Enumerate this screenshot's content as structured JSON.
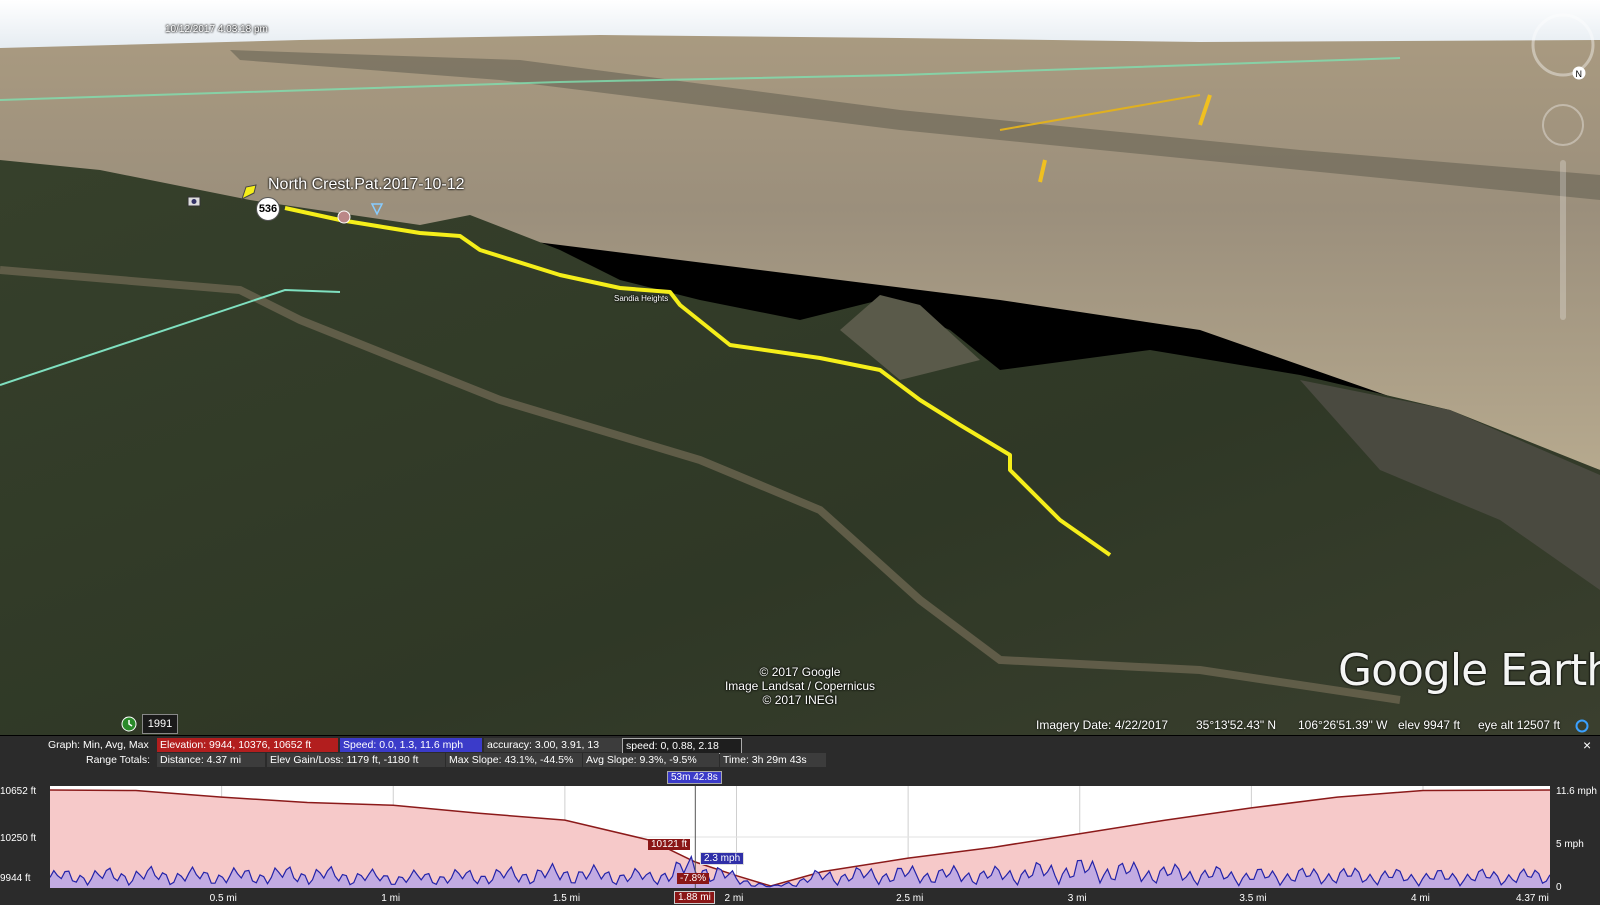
{
  "map": {
    "timestamp": "10/12/2017   4:03:18 pm",
    "track_label": "North Crest.Pat.2017-10-12",
    "track_marker_number": "536",
    "waypoint_label": "Sandia Heights",
    "copyright_lines": [
      "© 2017 Google",
      "Image Landsat / Copernicus",
      "© 2017 INEGI"
    ],
    "logo": "Google Earth",
    "historical_year": "1991",
    "track_color": "#f5ee1a",
    "icons": [
      "history-clock-icon",
      "placemark-pin-icon",
      "camera-icon",
      "compass-north-icon",
      "zoom-slider-icon",
      "look-around-icon"
    ]
  },
  "status_bar": {
    "imagery_date": "Imagery Date: 4/22/2017",
    "latitude": "35°13'52.43\" N",
    "longitude": "106°26'51.39\" W",
    "elev": "elev  9947 ft",
    "eye_alt": "eye alt  12507 ft"
  },
  "elevation_panel": {
    "row1_label": "Graph: Min, Avg, Max",
    "elevation": "Elevation: 9944, 10376, 10652 ft",
    "speed": "Speed: 0.0, 1.3, 11.6 mph",
    "accuracy": "accuracy: 3.00, 3.91, 13",
    "speed2": "speed: 0, 0.88, 2.18",
    "row2_label": "Range Totals:",
    "distance": "Distance: 4.37 mi",
    "elev_gain_loss": "Elev Gain/Loss: 1179 ft, -1180 ft",
    "max_slope": "Max Slope: 43.1%, -44.5%",
    "avg_slope": "Avg Slope: 9.3%, -9.5%",
    "time": "Time: 3h 29m 43s",
    "close": "×",
    "y_left": [
      "10652 ft",
      "10250 ft",
      "9944 ft"
    ],
    "y_right": [
      "11.6 mph",
      "5 mph",
      "0"
    ],
    "x_ticks": [
      "0.5 mi",
      "1 mi",
      "1.5 mi",
      "2 mi",
      "2.5 mi",
      "3 mi",
      "3.5 mi",
      "4 mi",
      "4.37 mi"
    ],
    "cursor": {
      "time": "53m 42.8s",
      "elevation": "10121 ft",
      "speed": "2.3 mph",
      "slope": "-7.8%",
      "distance": "1.88 mi"
    },
    "colors": {
      "elevation": "#8b1a1a",
      "elevation_fill": "#f6c9c9",
      "speed": "#2323a8",
      "speed_fill": "#b9a6e6"
    }
  },
  "chart_data": {
    "type": "area",
    "x": [
      0,
      0.25,
      0.5,
      0.75,
      1,
      1.25,
      1.5,
      1.75,
      1.88,
      2,
      2.1,
      2.25,
      2.5,
      2.75,
      3,
      3.25,
      3.5,
      3.75,
      4,
      4.37
    ],
    "series": [
      {
        "name": "Elevation",
        "values": [
          10652,
          10648,
          10600,
          10560,
          10540,
          10480,
          10430,
          10280,
          10121,
          10020,
          9944,
          10050,
          10150,
          10230,
          10330,
          10430,
          10520,
          10600,
          10648,
          10652
        ]
      },
      {
        "name": "Speed",
        "values": [
          1.2,
          1.4,
          1.3,
          1.5,
          1.1,
          1.3,
          1.6,
          1.2,
          2.3,
          1.0,
          0.1,
          1.3,
          1.5,
          1.4,
          2.0,
          1.6,
          1.3,
          1.4,
          1.2,
          1.3
        ]
      }
    ],
    "xlim": [
      0,
      4.37
    ],
    "ylim_left": [
      9944,
      10652
    ],
    "ylim_right": [
      0,
      11.6
    ]
  }
}
